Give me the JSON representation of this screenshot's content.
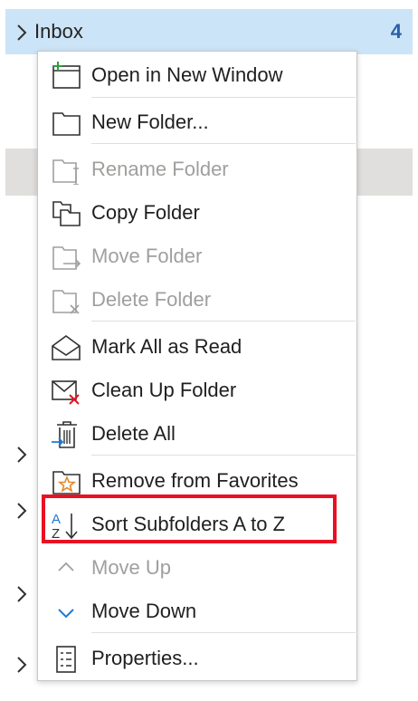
{
  "folder_pane": {
    "inbox_label": "Inbox",
    "inbox_count": "4"
  },
  "menu": {
    "items": [
      {
        "label": "Open in New Window",
        "icon": "open-new-window-icon",
        "enabled": true
      },
      {
        "label": "New Folder...",
        "icon": "new-folder-icon",
        "enabled": true
      },
      {
        "label": "Rename Folder",
        "icon": "rename-folder-icon",
        "enabled": false
      },
      {
        "label": "Copy Folder",
        "icon": "copy-folder-icon",
        "enabled": true
      },
      {
        "label": "Move Folder",
        "icon": "move-folder-icon",
        "enabled": false
      },
      {
        "label": "Delete Folder",
        "icon": "delete-folder-icon",
        "enabled": false
      },
      {
        "label": "Mark All as Read",
        "icon": "mark-read-icon",
        "enabled": true
      },
      {
        "label": "Clean Up Folder",
        "icon": "clean-up-icon",
        "enabled": true
      },
      {
        "label": "Delete All",
        "icon": "delete-all-icon",
        "enabled": true
      },
      {
        "label": "Remove from Favorites",
        "icon": "favorite-folder-icon",
        "enabled": true
      },
      {
        "label": "Sort Subfolders A to Z",
        "icon": "sort-az-icon",
        "enabled": true
      },
      {
        "label": "Move Up",
        "icon": "chevron-up-icon",
        "enabled": false
      },
      {
        "label": "Move Down",
        "icon": "chevron-down-icon",
        "enabled": true
      },
      {
        "label": "Properties...",
        "icon": "properties-icon",
        "enabled": true
      }
    ]
  },
  "colors": {
    "selection_blue": "#cce4f7",
    "count_blue": "#2b5fa8",
    "highlight_red": "#e81123",
    "disabled_text": "#a19f9d",
    "accent_blue": "#1f7ad6"
  }
}
